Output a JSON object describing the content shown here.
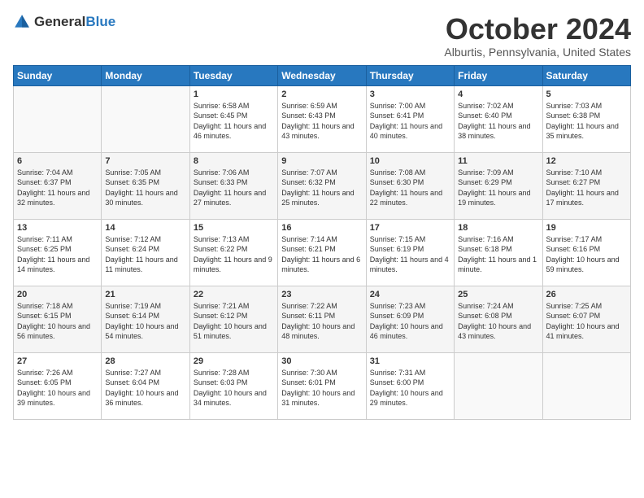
{
  "logo": {
    "text_general": "General",
    "text_blue": "Blue"
  },
  "title": "October 2024",
  "location": "Alburtis, Pennsylvania, United States",
  "weekdays": [
    "Sunday",
    "Monday",
    "Tuesday",
    "Wednesday",
    "Thursday",
    "Friday",
    "Saturday"
  ],
  "weeks": [
    [
      {
        "day": "",
        "info": ""
      },
      {
        "day": "",
        "info": ""
      },
      {
        "day": "1",
        "info": "Sunrise: 6:58 AM\nSunset: 6:45 PM\nDaylight: 11 hours and 46 minutes."
      },
      {
        "day": "2",
        "info": "Sunrise: 6:59 AM\nSunset: 6:43 PM\nDaylight: 11 hours and 43 minutes."
      },
      {
        "day": "3",
        "info": "Sunrise: 7:00 AM\nSunset: 6:41 PM\nDaylight: 11 hours and 40 minutes."
      },
      {
        "day": "4",
        "info": "Sunrise: 7:02 AM\nSunset: 6:40 PM\nDaylight: 11 hours and 38 minutes."
      },
      {
        "day": "5",
        "info": "Sunrise: 7:03 AM\nSunset: 6:38 PM\nDaylight: 11 hours and 35 minutes."
      }
    ],
    [
      {
        "day": "6",
        "info": "Sunrise: 7:04 AM\nSunset: 6:37 PM\nDaylight: 11 hours and 32 minutes."
      },
      {
        "day": "7",
        "info": "Sunrise: 7:05 AM\nSunset: 6:35 PM\nDaylight: 11 hours and 30 minutes."
      },
      {
        "day": "8",
        "info": "Sunrise: 7:06 AM\nSunset: 6:33 PM\nDaylight: 11 hours and 27 minutes."
      },
      {
        "day": "9",
        "info": "Sunrise: 7:07 AM\nSunset: 6:32 PM\nDaylight: 11 hours and 25 minutes."
      },
      {
        "day": "10",
        "info": "Sunrise: 7:08 AM\nSunset: 6:30 PM\nDaylight: 11 hours and 22 minutes."
      },
      {
        "day": "11",
        "info": "Sunrise: 7:09 AM\nSunset: 6:29 PM\nDaylight: 11 hours and 19 minutes."
      },
      {
        "day": "12",
        "info": "Sunrise: 7:10 AM\nSunset: 6:27 PM\nDaylight: 11 hours and 17 minutes."
      }
    ],
    [
      {
        "day": "13",
        "info": "Sunrise: 7:11 AM\nSunset: 6:25 PM\nDaylight: 11 hours and 14 minutes."
      },
      {
        "day": "14",
        "info": "Sunrise: 7:12 AM\nSunset: 6:24 PM\nDaylight: 11 hours and 11 minutes."
      },
      {
        "day": "15",
        "info": "Sunrise: 7:13 AM\nSunset: 6:22 PM\nDaylight: 11 hours and 9 minutes."
      },
      {
        "day": "16",
        "info": "Sunrise: 7:14 AM\nSunset: 6:21 PM\nDaylight: 11 hours and 6 minutes."
      },
      {
        "day": "17",
        "info": "Sunrise: 7:15 AM\nSunset: 6:19 PM\nDaylight: 11 hours and 4 minutes."
      },
      {
        "day": "18",
        "info": "Sunrise: 7:16 AM\nSunset: 6:18 PM\nDaylight: 11 hours and 1 minute."
      },
      {
        "day": "19",
        "info": "Sunrise: 7:17 AM\nSunset: 6:16 PM\nDaylight: 10 hours and 59 minutes."
      }
    ],
    [
      {
        "day": "20",
        "info": "Sunrise: 7:18 AM\nSunset: 6:15 PM\nDaylight: 10 hours and 56 minutes."
      },
      {
        "day": "21",
        "info": "Sunrise: 7:19 AM\nSunset: 6:14 PM\nDaylight: 10 hours and 54 minutes."
      },
      {
        "day": "22",
        "info": "Sunrise: 7:21 AM\nSunset: 6:12 PM\nDaylight: 10 hours and 51 minutes."
      },
      {
        "day": "23",
        "info": "Sunrise: 7:22 AM\nSunset: 6:11 PM\nDaylight: 10 hours and 48 minutes."
      },
      {
        "day": "24",
        "info": "Sunrise: 7:23 AM\nSunset: 6:09 PM\nDaylight: 10 hours and 46 minutes."
      },
      {
        "day": "25",
        "info": "Sunrise: 7:24 AM\nSunset: 6:08 PM\nDaylight: 10 hours and 43 minutes."
      },
      {
        "day": "26",
        "info": "Sunrise: 7:25 AM\nSunset: 6:07 PM\nDaylight: 10 hours and 41 minutes."
      }
    ],
    [
      {
        "day": "27",
        "info": "Sunrise: 7:26 AM\nSunset: 6:05 PM\nDaylight: 10 hours and 39 minutes."
      },
      {
        "day": "28",
        "info": "Sunrise: 7:27 AM\nSunset: 6:04 PM\nDaylight: 10 hours and 36 minutes."
      },
      {
        "day": "29",
        "info": "Sunrise: 7:28 AM\nSunset: 6:03 PM\nDaylight: 10 hours and 34 minutes."
      },
      {
        "day": "30",
        "info": "Sunrise: 7:30 AM\nSunset: 6:01 PM\nDaylight: 10 hours and 31 minutes."
      },
      {
        "day": "31",
        "info": "Sunrise: 7:31 AM\nSunset: 6:00 PM\nDaylight: 10 hours and 29 minutes."
      },
      {
        "day": "",
        "info": ""
      },
      {
        "day": "",
        "info": ""
      }
    ]
  ]
}
